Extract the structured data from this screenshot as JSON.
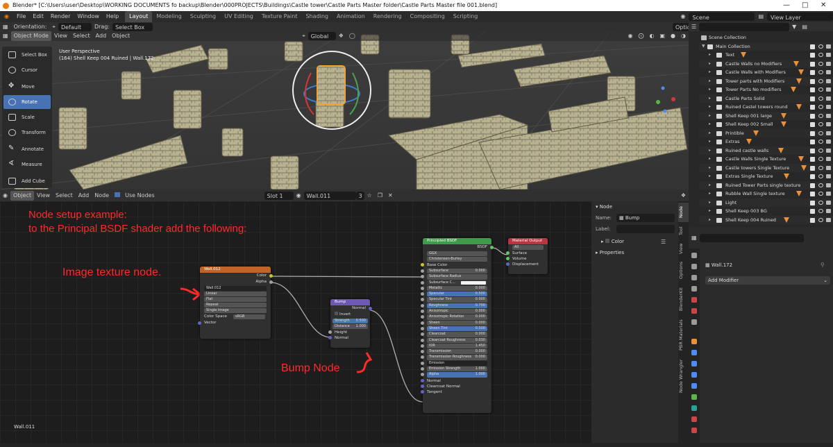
{
  "window": {
    "title": "Blender* [C:\\Users\\user\\Desktop\\WORKING DOCUMENTS fo backup\\Blender\\000PROJECTS\\Buildings\\Castle tower\\Castle Parts Master folder\\Castle Parts Master file 001.blend]"
  },
  "menu": [
    "File",
    "Edit",
    "Render",
    "Window",
    "Help"
  ],
  "workspaces": [
    "Layout",
    "Modeling",
    "Sculpting",
    "UV Editing",
    "Texture Paint",
    "Shading",
    "Animation",
    "Rendering",
    "Compositing",
    "Scripting"
  ],
  "active_workspace": "Layout",
  "scene": "Scene",
  "view_layer": "View Layer",
  "viewport_header": {
    "orientation_label": "Orientation:",
    "orientation": "Default",
    "drag_label": "Drag:",
    "drag": "Select Box",
    "mode": "Object Mode",
    "view": "View",
    "select": "Select",
    "add": "Add",
    "object": "Object",
    "transform": "Global",
    "options": "Options"
  },
  "viewport_info": {
    "line1": "User Perspective",
    "line2": "(164) Shell Keep 004 Ruined | Wall.172"
  },
  "tools": [
    "Select Box",
    "Cursor",
    "Move",
    "Rotate",
    "Scale",
    "Transform",
    "Annotate",
    "Measure",
    "Add Cube"
  ],
  "active_tool": "Rotate",
  "outliner": {
    "root": "Scene Collection",
    "main": "Main Collection",
    "items": [
      "Text",
      "Castle Walls no Modifiers",
      "Castle Walls with Modifiers",
      "Tower parts with Modifiers",
      "Tower Parts No modifiers",
      "Castle Parts Solid",
      "Ruined Castel towers round",
      "Shell Keep 001 large",
      "Shell Keep 002 Small",
      "Printible",
      "Extras",
      "Ruined castle walls",
      "Castle Walls Single Texture",
      "Castle towers Single Texture",
      "Extras Single Texture",
      "Ruined Tower Parts single texture",
      "Rubble Wall Single texture",
      "Light",
      "Shell Keep 003 BG",
      "Shell Keep 004 Ruined"
    ]
  },
  "node_header": {
    "object": "Object",
    "view": "View",
    "select": "Select",
    "add": "Add",
    "node": "Node",
    "use_nodes": "Use Nodes",
    "slot": "Slot 1",
    "material": "Wall.011",
    "users": "3"
  },
  "annotations": {
    "setup_line1": "Node setup example:",
    "setup_line2": "to the Principal BSDF shader add the following:",
    "image_texture": "Image texture node.",
    "bump": "Bump Node"
  },
  "image_node": {
    "title": "Wall.012",
    "out_color": "Color",
    "out_alpha": "Alpha",
    "image": "Wall.012",
    "interp": "Linear",
    "projection": "Flat",
    "extension": "Repeat",
    "source": "Single Image",
    "color_space_label": "Color Space",
    "color_space": "sRGB",
    "vector": "Vector"
  },
  "bump_node": {
    "title": "Bump",
    "out_normal": "Normal",
    "invert": "Invert",
    "strength_label": "Strength",
    "strength": "0.500",
    "distance_label": "Distance",
    "distance": "1.000",
    "height": "Height",
    "normal": "Normal"
  },
  "bsdf_node": {
    "title": "Principled BSDF",
    "out": "BSDF",
    "distribution": "GGX",
    "subsurface_method": "Christensen-Burley",
    "base_color": "Base Color",
    "fields": [
      {
        "label": "Subsurface",
        "value": "0.000",
        "style": "grey"
      },
      {
        "label": "Subsurface Radius",
        "value": "",
        "style": "grey"
      },
      {
        "label": "Subsurface C...",
        "value": "",
        "style": "white"
      },
      {
        "label": "Metallic",
        "value": "0.000",
        "style": "grey"
      },
      {
        "label": "Specular",
        "value": "0.500",
        "style": "blue"
      },
      {
        "label": "Specular Tint",
        "value": "0.000",
        "style": "grey"
      },
      {
        "label": "Roughness",
        "value": "0.700",
        "style": "blue"
      },
      {
        "label": "Anisotropic",
        "value": "0.000",
        "style": "grey"
      },
      {
        "label": "Anisotropic Rotation",
        "value": "0.000",
        "style": "grey"
      },
      {
        "label": "Sheen",
        "value": "0.000",
        "style": "grey"
      },
      {
        "label": "Sheen Tint",
        "value": "0.500",
        "style": "blue"
      },
      {
        "label": "Clearcoat",
        "value": "0.000",
        "style": "grey"
      },
      {
        "label": "Clearcoat Roughness",
        "value": "0.030",
        "style": "grey"
      },
      {
        "label": "IOR",
        "value": "1.450",
        "style": "grey"
      },
      {
        "label": "Transmission",
        "value": "0.000",
        "style": "grey"
      },
      {
        "label": "Transmission Roughness",
        "value": "0.000",
        "style": "grey"
      },
      {
        "label": "Emission",
        "value": "",
        "style": "dark"
      },
      {
        "label": "Emission Strength",
        "value": "1.000",
        "style": "grey"
      },
      {
        "label": "Alpha",
        "value": "1.000",
        "style": "blue"
      }
    ],
    "normal": "Normal",
    "clearcoat_normal": "Clearcoat Normal",
    "tangent": "Tangent"
  },
  "output_node": {
    "title": "Material Output",
    "target": "All",
    "surface": "Surface",
    "volume": "Volume",
    "displacement": "Displacement"
  },
  "node_panel": {
    "title": "Node",
    "name_label": "Name:",
    "name": "Bump",
    "label_label": "Label:",
    "color": "Color",
    "properties": "Properties"
  },
  "side_tabs": [
    "Node",
    "Tool",
    "View",
    "Options",
    "BlenderKit",
    "PBR Materials",
    "Node Wrangler"
  ],
  "properties": {
    "object": "Wall.172",
    "add_modifier": "Add Modifier"
  },
  "material_footer": "Wall.011",
  "colors": {
    "accent": "#4772b3",
    "image_header": "#c0652a",
    "bump_header": "#6e58b5",
    "bsdf_header": "#3e9b4b",
    "output_header": "#b83541",
    "annotation": "#ff2a2a"
  }
}
